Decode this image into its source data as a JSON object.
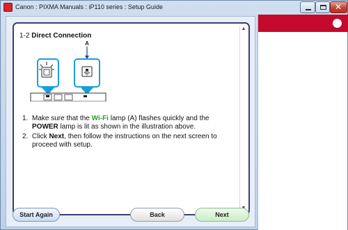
{
  "window": {
    "title": "Canon : PIXMA Manuals : iP110 series : Setup Guide",
    "controls": {
      "minimize": "",
      "maximize": "",
      "close": "✕"
    }
  },
  "content": {
    "section_number": "1-2",
    "section_title": "Direct Connection",
    "callout_label": "A",
    "instructions": [
      {
        "num": "1.",
        "pre": "Make sure that the ",
        "wifi": "Wi-Fi",
        "mid": " lamp (A) flashes quickly and the ",
        "power": "POWER",
        "post": " lamp is lit as shown in the illustration above."
      },
      {
        "num": "2.",
        "pre": "Click ",
        "next": "Next",
        "post": ", then follow the instructions on the next screen to proceed with setup."
      }
    ]
  },
  "buttons": {
    "start_again": "Start Again",
    "back": "Back",
    "next": "Next"
  },
  "colors": {
    "wifi_green": "#2a9d2e",
    "banner_red": "#c4092c",
    "callout_blue": "#1a9ed9"
  },
  "icons": [
    "canon-app-icon",
    "power-lamp-icon",
    "wifi-lamp-icon",
    "scroll-up-arrow-icon",
    "scroll-down-arrow-icon"
  ]
}
